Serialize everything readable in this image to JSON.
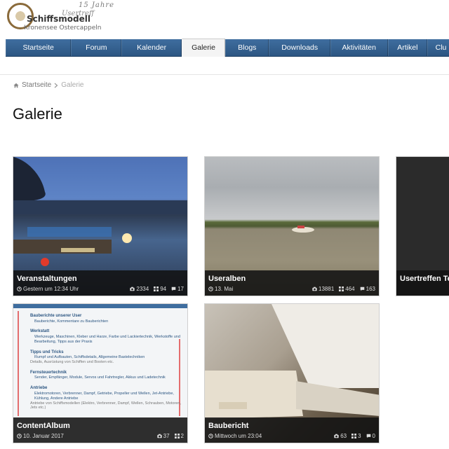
{
  "logo": {
    "line1": "15 Jahre",
    "line2": "Schiffsmodell",
    "line3": "Kronensee Ostercappeln",
    "line4": "Usertreff"
  },
  "nav": {
    "items": [
      {
        "label": "Startseite",
        "active": false
      },
      {
        "label": "Forum",
        "active": false
      },
      {
        "label": "Kalender",
        "active": false
      },
      {
        "label": "Galerie",
        "active": true
      },
      {
        "label": "Blogs",
        "active": false
      },
      {
        "label": "Downloads",
        "active": false
      },
      {
        "label": "Aktivitäten",
        "active": false
      },
      {
        "label": "Artikel",
        "active": false
      },
      {
        "label": "Clu",
        "active": false
      }
    ]
  },
  "breadcrumb": {
    "home": "Startseite",
    "current": "Galerie"
  },
  "page": {
    "title": "Galerie"
  },
  "albums": [
    {
      "title": "Veranstaltungen",
      "date": "Gestern um 12:34 Uhr",
      "images": "2334",
      "albums": "94",
      "comments": "17"
    },
    {
      "title": "Useralben",
      "date": "13. Mai",
      "images": "13881",
      "albums": "464",
      "comments": "163"
    },
    {
      "title": "Usertreffen Teil"
    },
    {
      "title": "ContentAlbum",
      "date": "10. Januar 2017",
      "images": "37",
      "albums": "2"
    },
    {
      "title": "Baubericht",
      "date": "Mittwoch um 23:04",
      "images": "63",
      "albums": "3",
      "comments": "0"
    }
  ],
  "content_preview": {
    "header": "Bauberichte unserer User",
    "sub1": "Bauberichte, Kommentare zu Bauberichten",
    "sec1": "Werkstatt",
    "sec1_items": "Werkzeuge, Maschinen, Kleber und Harze, Farbe und Lackiertechnik, Werkstoffe und Bearbeitung, Tipps aus der Praxis",
    "sec2": "Tipps und Tricks",
    "sec2_items": "Rumpf und Aufbauten, Schiffsdetails, Allgemeine Bastelechniken",
    "sec2_desc": "Details, Ausrüstung von Schiffen und Booten etc.",
    "sec3": "Fernsteuertechnik",
    "sec3_items": "Sender, Empfänger, Module, Servos und Fahrtregler, Akkus und Ladetechnik",
    "sec4": "Antriebe",
    "sec4_items": "Elektromotoren, Verbrenner, Dampf, Getriebe, Propeller und Wellen, Jet-Antriebe, Kühlung, Andere Antriebe",
    "sec4_desc": "Antriebe von Schiffsmodellen (Elektro, Verbrenner, Dampf, Wellen, Schrauben, Motoren, Jets etc.)"
  },
  "colors": {
    "nav_bg": "#2c5682",
    "overlay": "#121212",
    "accent": "#3f6e9f"
  },
  "icons": {
    "home": "home-icon",
    "clock": "clock-icon",
    "camera": "camera-icon",
    "grid": "grid-icon",
    "comment": "comment-icon",
    "chevron": "chevron-right-icon"
  }
}
